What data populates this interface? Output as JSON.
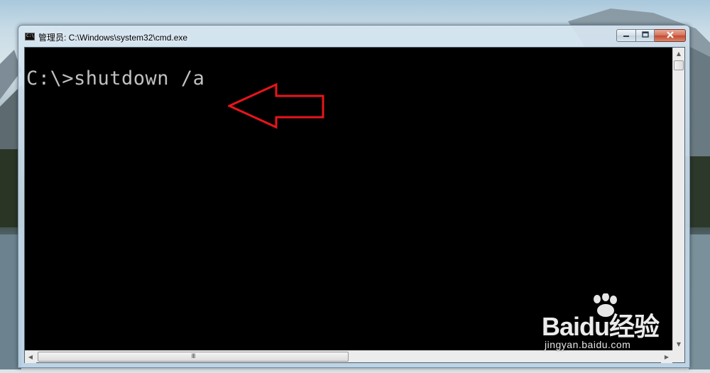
{
  "window": {
    "title": "管理员: C:\\Windows\\system32\\cmd.exe",
    "icon": "cmd-icon",
    "controls": {
      "minimize": "minimize-icon",
      "maximize": "maximize-icon",
      "close": "close-icon"
    }
  },
  "console": {
    "line1": "C:\\>shutdown /a",
    "background": "#000000",
    "foreground": "#c0c0c0"
  },
  "annotation": {
    "type": "arrow-left",
    "color": "#e8141c"
  },
  "scrollbars": {
    "h_thumb_grip": "III"
  },
  "watermark": {
    "brand": "Baidu经验",
    "url": "jingyan.baidu.com"
  }
}
